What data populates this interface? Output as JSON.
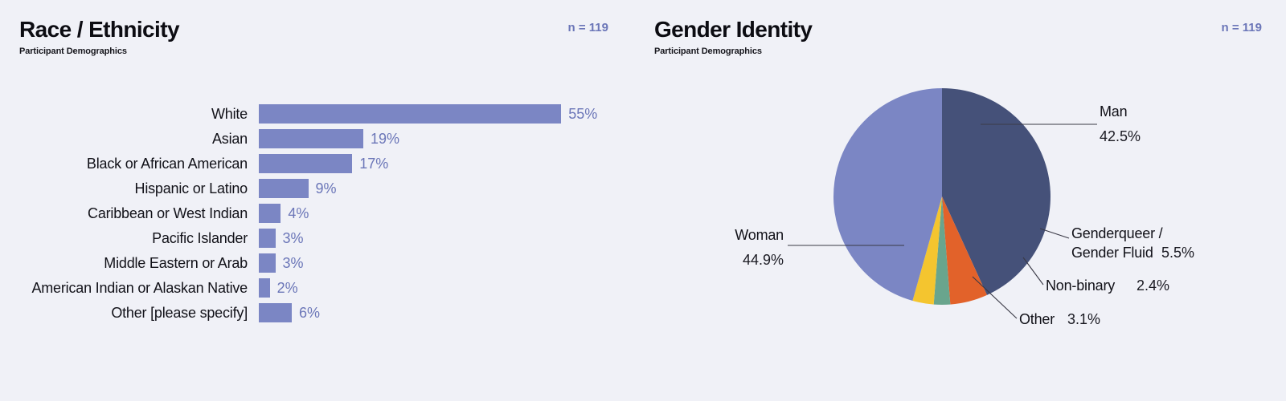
{
  "background_color": "#f0f1f7",
  "accent_color": "#7b86c4",
  "muted_label_color": "#6b76b8",
  "panels": {
    "race": {
      "title": "Race / Ethnicity",
      "subtitle": "Participant Demographics",
      "sample_size": "n = 119"
    },
    "gender": {
      "title": "Gender Identity",
      "subtitle": "Participant Demographics",
      "sample_size": "n = 119"
    }
  },
  "chart_data": [
    {
      "type": "bar",
      "title": "Race / Ethnicity",
      "subtitle": "Participant Demographics",
      "orientation": "horizontal",
      "xlabel": "",
      "ylabel": "",
      "grid": false,
      "legend": "none",
      "bar_color": "#7b86c4",
      "value_suffix": "%",
      "sample_size": 119,
      "xlim": [
        0,
        55
      ],
      "categories": [
        "White",
        "Asian",
        "Black or African American",
        "Hispanic or Latino",
        "Caribbean or West Indian",
        "Pacific Islander",
        "Middle Eastern or Arab",
        "American Indian or Alaskan Native",
        "Other [please specify]"
      ],
      "values": [
        55,
        19,
        17,
        9,
        4,
        3,
        3,
        2,
        6
      ],
      "value_labels": [
        "55%",
        "19%",
        "17%",
        "9%",
        "4%",
        "3%",
        "3%",
        "2%",
        "6%"
      ]
    },
    {
      "type": "pie",
      "title": "Gender Identity",
      "subtitle": "Participant Demographics",
      "legend": "callout-labels",
      "sample_size": 119,
      "categories": [
        "Man",
        "Woman",
        "Other",
        "Non-binary",
        "Genderqueer / Gender Fluid"
      ],
      "values": [
        42.5,
        44.9,
        3.1,
        2.4,
        5.5
      ],
      "value_labels": [
        "42.5%",
        "44.9%",
        "3.1%",
        "2.4%",
        "5.5%"
      ],
      "colors": [
        "#455179",
        "#7b86c4",
        "#f4c52f",
        "#69a58d",
        "#e2622a"
      ],
      "slices": [
        {
          "label": "Man",
          "value": 42.5,
          "value_label": "42.5%",
          "color": "#455179"
        },
        {
          "label": "Woman",
          "value": 44.9,
          "value_label": "44.9%",
          "color": "#7b86c4"
        },
        {
          "label": "Other",
          "value": 3.1,
          "value_label": "3.1%",
          "color": "#f4c52f"
        },
        {
          "label": "Non-binary",
          "value": 2.4,
          "value_label": "2.4%",
          "color": "#69a58d"
        },
        {
          "label": "Genderqueer /",
          "label2": "Gender Fluid",
          "value": 5.5,
          "value_label": "5.5%",
          "color": "#e2622a"
        }
      ]
    }
  ]
}
